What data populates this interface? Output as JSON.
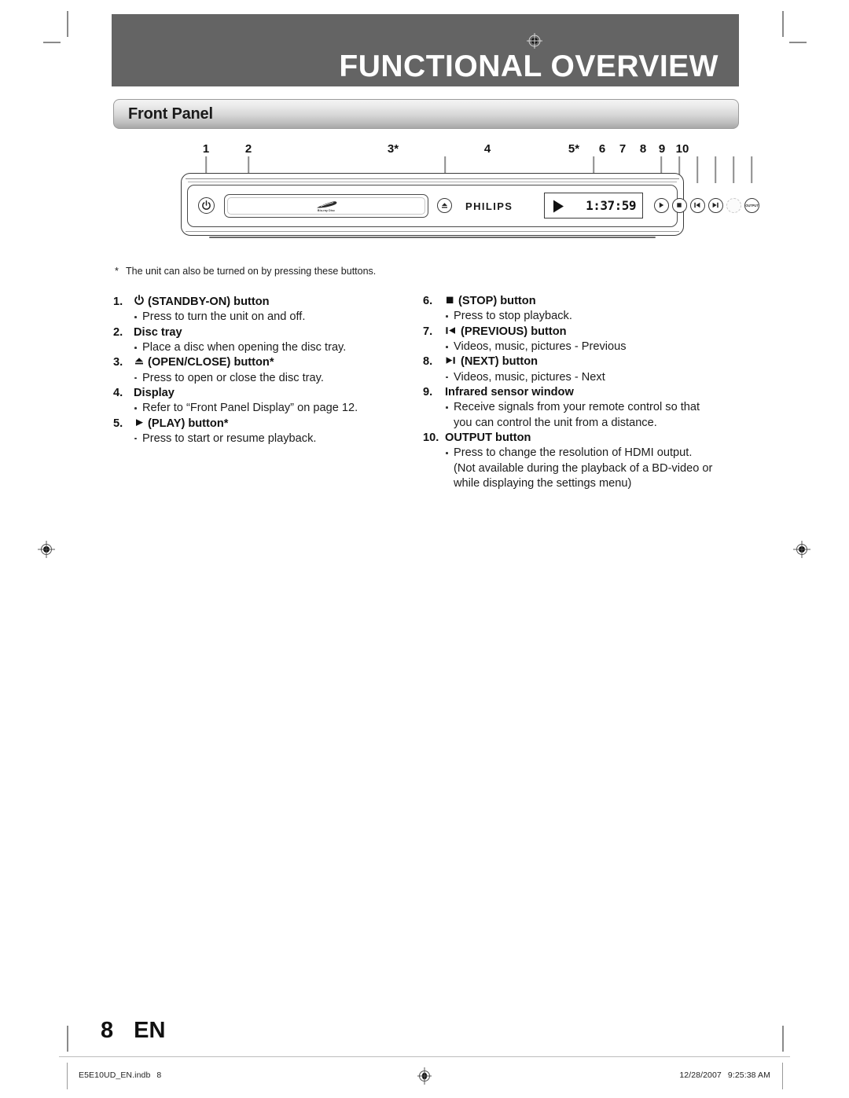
{
  "header": {
    "chapter_title": "FUNCTIONAL OVERVIEW",
    "section_title": "Front Panel",
    "bg_color": "#646464"
  },
  "figure": {
    "callouts": [
      "1",
      "2",
      "3*",
      "4",
      "5*",
      "6",
      "7",
      "8",
      "9",
      "10"
    ],
    "brand": "PHILIPS",
    "disc_logo_text": "Blu-ray Disc",
    "display_time": "1:37:59",
    "output_button_label": "OUTPUT",
    "footnote_marker": "*",
    "footnote": "The unit can also be turned on by pressing these buttons."
  },
  "items_left": [
    {
      "num": "1.",
      "icon": "power-icon",
      "title": "(STANDBY-ON) button",
      "bullets": [
        "Press to turn the unit on and off."
      ]
    },
    {
      "num": "2.",
      "icon": "none",
      "title": "Disc tray",
      "bullets": [
        "Place a disc when opening the disc tray."
      ]
    },
    {
      "num": "3.",
      "icon": "eject-icon",
      "title": "(OPEN/CLOSE) button*",
      "bullets": [
        "Press to open or close the disc tray."
      ]
    },
    {
      "num": "4.",
      "icon": "none",
      "title": "Display",
      "bullets": [
        "Refer to “Front Panel Display” on page 12."
      ]
    },
    {
      "num": "5.",
      "icon": "play-icon",
      "title": "(PLAY) button*",
      "bullets": [
        "Press to start or resume playback."
      ]
    }
  ],
  "items_right": [
    {
      "num": "6.",
      "icon": "stop-icon",
      "title": "(STOP) button",
      "bullets": [
        "Press to stop playback."
      ]
    },
    {
      "num": "7.",
      "icon": "previous-icon",
      "title": "(PREVIOUS) button",
      "bullets": [
        "Videos, music, pictures - Previous"
      ]
    },
    {
      "num": "8.",
      "icon": "next-icon",
      "title": "(NEXT) button",
      "bullets": [
        "Videos, music, pictures - Next"
      ]
    },
    {
      "num": "9.",
      "icon": "none",
      "title": "Infrared sensor window",
      "bullets": [
        "Receive signals from your remote control so that",
        "you can control the unit from a distance."
      ],
      "continuation_from": 1
    },
    {
      "num": "10.",
      "icon": "none",
      "title": "OUTPUT button",
      "bullets": [
        "Press to change the resolution of HDMI output.",
        "(Not available during the playback of a BD-video or",
        "while displaying the settings menu)"
      ],
      "continuation_from": 1
    }
  ],
  "footer": {
    "page_number": "8",
    "language_code": "EN",
    "filename": "E5E10UD_EN.indb",
    "file_page": "8",
    "date": "12/28/2007",
    "time": "9:25:38 AM"
  }
}
